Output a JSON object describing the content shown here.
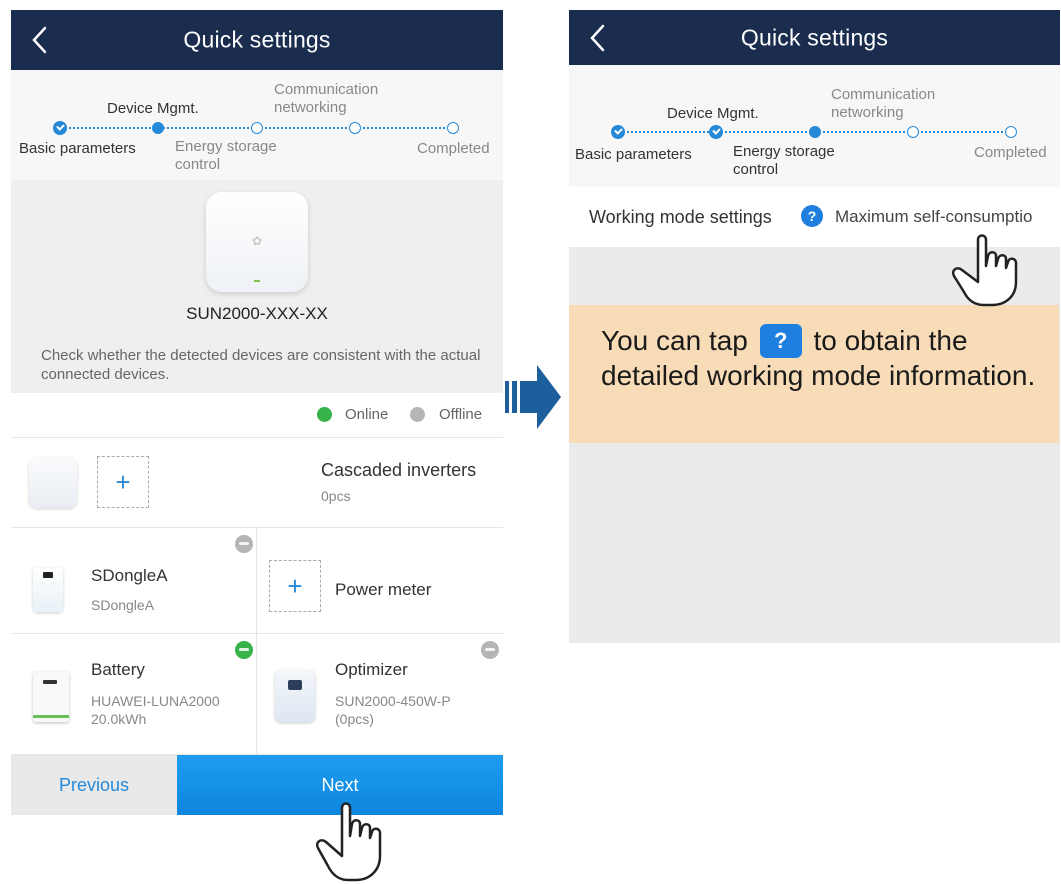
{
  "left": {
    "header": {
      "title": "Quick settings"
    },
    "stepper": {
      "steps": [
        "Basic parameters",
        "Device Mgmt.",
        "Energy storage\ncontrol",
        "Communication\nnetworking",
        "Completed"
      ]
    },
    "device": {
      "model": "SUN2000-XXX-XX",
      "hint": "Check whether the detected devices are consistent with the actual connected devices."
    },
    "legend": {
      "online": "Online",
      "offline": "Offline",
      "online_color": "#37b34a",
      "offline_color": "#b5b5b5"
    },
    "cascade": {
      "title": "Cascaded inverters",
      "count": "0pcs",
      "add_icon": "+"
    },
    "devices": [
      {
        "name": "SDongleA",
        "sub": "SDongleA",
        "status": "offline"
      },
      {
        "name": "Power meter",
        "add_icon": "+"
      },
      {
        "name": "Battery",
        "sub": "HUAWEI-LUNA2000\n20.0kWh",
        "status": "online"
      },
      {
        "name": "Optimizer",
        "sub": "SUN2000-450W-P\n(0pcs)",
        "status": "offline"
      }
    ],
    "buttons": {
      "previous": "Previous",
      "next": "Next"
    }
  },
  "right": {
    "header": {
      "title": "Quick settings"
    },
    "stepper": {
      "steps": [
        "Basic parameters",
        "Device Mgmt.",
        "Energy storage\ncontrol",
        "Communication\nnetworking",
        "Completed"
      ]
    },
    "working_mode": {
      "label": "Working mode settings",
      "help_icon": "?",
      "value": "Maximum self-consumptio"
    }
  },
  "callout": {
    "before": "You can tap",
    "icon": "?",
    "after": "to obtain the detailed working mode information."
  },
  "colors": {
    "header_bg": "#1b2d4f",
    "accent": "#2589d8",
    "next_button": "#0d86dc",
    "callout_bg": "#f8dcb8",
    "arrow": "#1c5f9c"
  }
}
